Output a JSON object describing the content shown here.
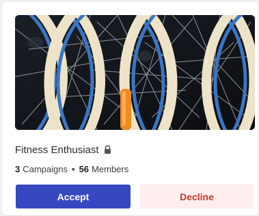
{
  "card": {
    "image_subject": "bicycle-wheels-photo",
    "title": "Fitness Enthusiast",
    "title_icon": "lock-icon",
    "stats": {
      "campaigns_count": "3",
      "campaigns_label": "Campaigns",
      "separator": "•",
      "members_count": "56",
      "members_label": "Members"
    },
    "actions": {
      "accept_label": "Accept",
      "decline_label": "Decline"
    }
  },
  "colors": {
    "accept_bg": "#3747c0",
    "accept_text": "#ffffff",
    "decline_bg": "#feeeed",
    "decline_text": "#c0392b",
    "tire_cream": "#ede3c8",
    "rim_blue": "#3a76c4",
    "reflector_orange": "#f28a1c"
  }
}
